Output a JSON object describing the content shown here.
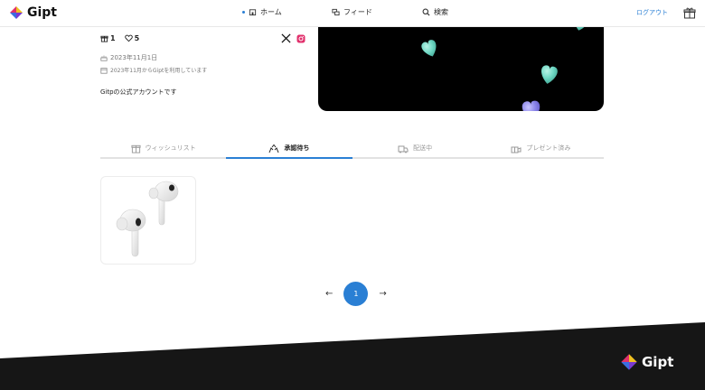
{
  "header": {
    "logo_text": "Gipt",
    "nav": [
      {
        "label": "ホーム",
        "icon": "home-icon",
        "active": true
      },
      {
        "label": "フィード",
        "icon": "feed-icon",
        "active": false
      },
      {
        "label": "検索",
        "icon": "search-icon",
        "active": false
      }
    ],
    "login_label": "ログアウト"
  },
  "profile": {
    "gift_count": "1",
    "likes_count": "5",
    "birthday": "2023年11月1日",
    "joined": "2023年11月からGiptを利用しています",
    "bio": "Gitpの公式アカウントです"
  },
  "tabs": [
    {
      "label": "ウィッシュリスト",
      "icon": "gift-box-icon",
      "active": false
    },
    {
      "label": "承認待ち",
      "icon": "hands-icon",
      "active": true
    },
    {
      "label": "配送中",
      "icon": "delivery-icon",
      "active": false
    },
    {
      "label": "プレゼント済み",
      "icon": "present-icon",
      "active": false
    }
  ],
  "pagination": {
    "current_page": "1",
    "prev": "←",
    "next": "→"
  },
  "footer": {
    "logo_text": "Gipt"
  },
  "colors": {
    "accent": "#2a7fd4",
    "footer_bg": "#161616",
    "heart_teal": "#6fd8c4",
    "heart_purple": "#8a84e8"
  }
}
